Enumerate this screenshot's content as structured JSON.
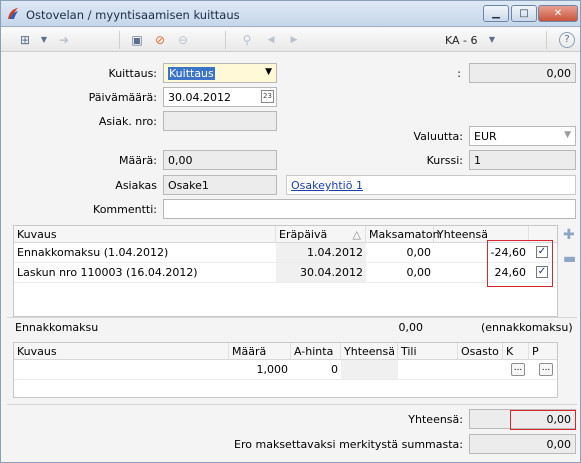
{
  "window": {
    "title": "Ostovelan / myyntisaamisen kuittaus"
  },
  "toolbar": {
    "ka": "KA - 6",
    "help": "?"
  },
  "form": {
    "kuittaus_label": "Kuittaus:",
    "kuittaus_value": "Kuittaus",
    "paivamaara_label": "Päivämäärä:",
    "paivamaara_value": "30.04.2012",
    "asiak_nro_label": "Asiak. nro:",
    "asiak_nro_value": "",
    "colon_label": ":",
    "top_right_value": "0,00",
    "valuutta_label": "Valuutta:",
    "valuutta_value": "EUR",
    "maara_label": "Määrä:",
    "maara_value": "0,00",
    "kurssi_label": "Kurssi:",
    "kurssi_value": "1",
    "asiakas_label": "Asiakas",
    "asiakas_value": "Osake1",
    "asiakas_link": "Osakeyhtiö 1",
    "kommentti_label": "Kommentti:",
    "kommentti_value": ""
  },
  "items_table": {
    "headers": {
      "kuvaus": "Kuvaus",
      "erapaiva": "Eräpäivä",
      "sort": "△",
      "maksamaton": "Maksamaton",
      "yhteensa": "Yhteensä"
    },
    "rows": [
      {
        "kuvaus": "Ennakkomaksu (1.04.2012)",
        "erapaiva": "1.04.2012",
        "maksamaton": "0,00",
        "yhteensa": "-24,60",
        "checked": "✓"
      },
      {
        "kuvaus": "Laskun nro 110003 (16.04.2012)",
        "erapaiva": "30.04.2012",
        "maksamaton": "0,00",
        "yhteensa": "24,60",
        "checked": "✓"
      }
    ]
  },
  "ennakko": {
    "label": "Ennakkomaksu",
    "value": "0,00",
    "suffix": "(ennakkomaksu)"
  },
  "rows_table": {
    "headers": {
      "kuvaus": "Kuvaus",
      "maara": "Määrä",
      "a_hinta": "A-hinta",
      "yhteensa": "Yhteensä",
      "tili": "Tili",
      "osasto": "Osasto",
      "k": "K",
      "p": "P"
    },
    "row": {
      "kuvaus": "",
      "maara": "1,000",
      "a_hinta": "0",
      "yhteensa": "",
      "tili": "",
      "osasto": "",
      "k_btn": "...",
      "p_btn": "..."
    }
  },
  "totals": {
    "yhteensa_label": "Yhteensä:",
    "yhteensa_value": "0,00",
    "ero_label": "Ero maksettavaksi merkitystä summasta:",
    "ero_value": "0,00"
  }
}
